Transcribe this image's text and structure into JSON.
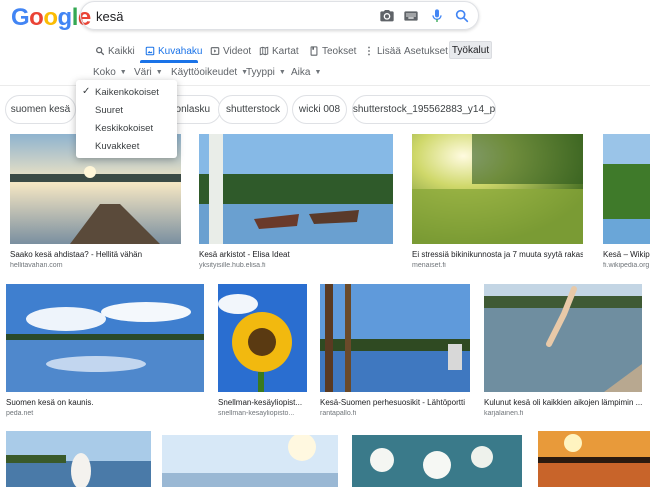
{
  "header": {
    "logo": "Google",
    "search_query": "kesä"
  },
  "tabs": [
    {
      "label": "Kaikki",
      "icon": "search-icon"
    },
    {
      "label": "Kuvahaku",
      "icon": "image-icon",
      "active": true
    },
    {
      "label": "Videot",
      "icon": "video-icon"
    },
    {
      "label": "Kartat",
      "icon": "map-icon"
    },
    {
      "label": "Teokset",
      "icon": "book-icon"
    },
    {
      "label": "Lisää",
      "icon": "more-icon"
    },
    {
      "label": "Asetukset"
    },
    {
      "label": "Työkalut"
    }
  ],
  "filters": [
    "Koko",
    "Väri",
    "Käyttöoikeudet",
    "Tyyppi",
    "Aika"
  ],
  "chips": [
    "suomen kesä",
    "onlasku",
    "shutterstock",
    "wicki 008",
    "shutterstock_195562883_y14_p"
  ],
  "size_dropdown": {
    "items": [
      "Kaikenkokoiset",
      "Suuret",
      "Keskikokoiset",
      "Kuvakkeet"
    ],
    "selected": "Kaikenkokoiset"
  },
  "results": [
    {
      "caption": "Saako kesä ahdistaa? - Hellitä vähän",
      "source": "hellitavahan.com"
    },
    {
      "caption": "Kesä arkistot - Elisa Ideat",
      "source": "yksityisille.hub.elisa.fi"
    },
    {
      "caption": "Ei stressiä bikinikunnosta ja 7 muuta syytä rakas...",
      "source": "menaiset.fi"
    },
    {
      "caption": "Kesä – Wikipe",
      "source": "fi.wikipedia.org"
    },
    {
      "caption": "Suomen kesä on kaunis.",
      "source": "peda.net"
    },
    {
      "caption": "Snellman-kesäyliopist...",
      "source": "snellman-kesayliopisto..."
    },
    {
      "caption": "Kesä-Suomen perhesuosikit - Lähtöportti",
      "source": "rantapallo.fi"
    },
    {
      "caption": "Kulunut kesä oli kaikkien aikojen lämpimin ...",
      "source": "karjalainen.fi"
    }
  ],
  "colors": {
    "accent": "#1a73e8",
    "logo_blue": "#4285f4",
    "logo_red": "#ea4335",
    "logo_yellow": "#fbbc05",
    "logo_green": "#34a853"
  }
}
